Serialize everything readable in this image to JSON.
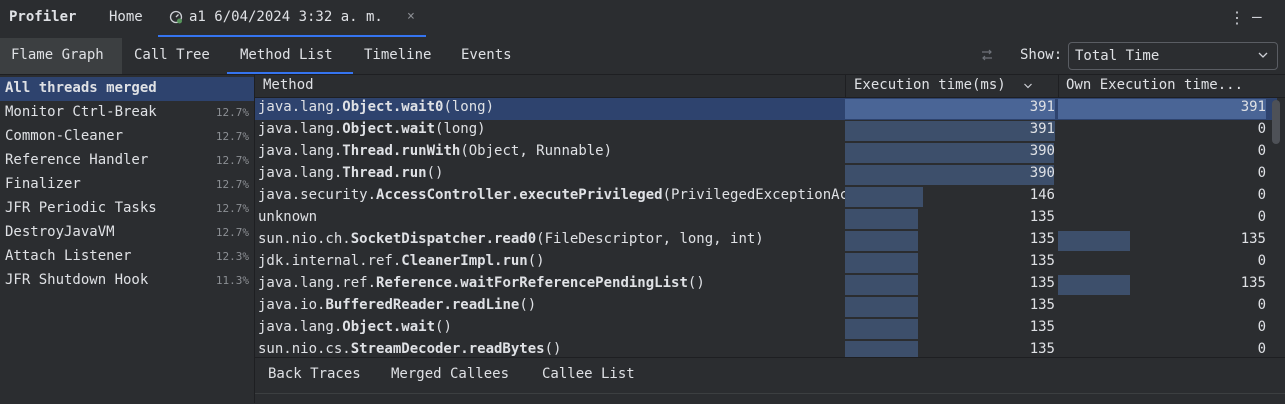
{
  "header": {
    "app_title": "Profiler",
    "home_tab": "Home",
    "run_tab_label": "a1 6/04/2024 3:32 a. m.",
    "close": "×",
    "menu": "⋮",
    "minimize": "—"
  },
  "views": {
    "tabs": [
      "Flame Graph",
      "Call Tree",
      "Method List",
      "Timeline",
      "Events"
    ],
    "active": "Method List",
    "show_label": "Show:",
    "show_value": "Total Time"
  },
  "threads": [
    {
      "name": "All threads merged",
      "pct": ""
    },
    {
      "name": "Monitor Ctrl-Break",
      "pct": "12.7%"
    },
    {
      "name": "Common-Cleaner",
      "pct": "12.7%"
    },
    {
      "name": "Reference Handler",
      "pct": "12.7%"
    },
    {
      "name": "Finalizer",
      "pct": "12.7%"
    },
    {
      "name": "JFR Periodic Tasks",
      "pct": "12.7%"
    },
    {
      "name": "DestroyJavaVM",
      "pct": "12.7%"
    },
    {
      "name": "Attach Listener",
      "pct": "12.3%"
    },
    {
      "name": "JFR Shutdown Hook",
      "pct": "11.3%"
    }
  ],
  "table": {
    "columns": [
      "Method",
      "Execution time(ms)",
      "Own Execution time..."
    ],
    "max_value": 391,
    "rows": [
      {
        "pre": "java.lang.",
        "bold": "Object.wait0",
        "post": "(long)",
        "exec": 391,
        "own": 391
      },
      {
        "pre": "java.lang.",
        "bold": "Object.wait",
        "post": "(long)",
        "exec": 391,
        "own": 0
      },
      {
        "pre": "java.lang.",
        "bold": "Thread.runWith",
        "post": "(Object, Runnable)",
        "exec": 390,
        "own": 0
      },
      {
        "pre": "java.lang.",
        "bold": "Thread.run",
        "post": "()",
        "exec": 390,
        "own": 0
      },
      {
        "pre": "java.security.",
        "bold": "AccessController.executePrivileged",
        "post": "(PrivilegedExceptionAction, AccessControlContext, Class)",
        "exec": 146,
        "own": 0
      },
      {
        "pre": "unknown",
        "bold": "",
        "post": "",
        "exec": 135,
        "own": 0
      },
      {
        "pre": "sun.nio.ch.",
        "bold": "SocketDispatcher.read0",
        "post": "(FileDescriptor, long, int)",
        "exec": 135,
        "own": 135
      },
      {
        "pre": "jdk.internal.ref.",
        "bold": "CleanerImpl.run",
        "post": "()",
        "exec": 135,
        "own": 0
      },
      {
        "pre": "java.lang.ref.",
        "bold": "Reference.waitForReferencePendingList",
        "post": "()",
        "exec": 135,
        "own": 135
      },
      {
        "pre": "java.io.",
        "bold": "BufferedReader.readLine",
        "post": "()",
        "exec": 135,
        "own": 0
      },
      {
        "pre": "java.lang.",
        "bold": "Object.wait",
        "post": "()",
        "exec": 135,
        "own": 0
      },
      {
        "pre": "sun.nio.cs.",
        "bold": "StreamDecoder.readBytes",
        "post": "()",
        "exec": 135,
        "own": 0
      }
    ]
  },
  "bottom_tabs": [
    "Back Traces",
    "Merged Callees",
    "Callee List"
  ]
}
